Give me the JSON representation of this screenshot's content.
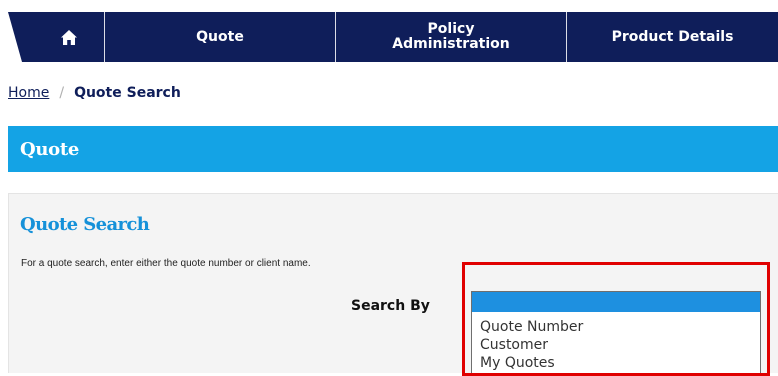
{
  "nav": {
    "home_icon": "home-icon",
    "items": [
      {
        "label": "Quote"
      },
      {
        "label": "Policy Administration"
      },
      {
        "label": "Product Details"
      }
    ]
  },
  "breadcrumb": {
    "home": "Home",
    "separator": "/",
    "current": "Quote Search"
  },
  "band": {
    "title": "Quote"
  },
  "panel": {
    "title": "Quote Search",
    "description": "For a quote search, enter either the quote number or client name.",
    "search_by_label": "Search By",
    "dropdown": {
      "selected": "",
      "options": [
        "",
        "Quote Number",
        "Customer",
        "My Quotes"
      ]
    }
  },
  "colors": {
    "nav_bg": "#0f1e5a",
    "band_bg": "#14a3e5",
    "title_blue": "#1591d9",
    "selected_option": "#1e90e0",
    "highlight_border": "#e00000"
  }
}
